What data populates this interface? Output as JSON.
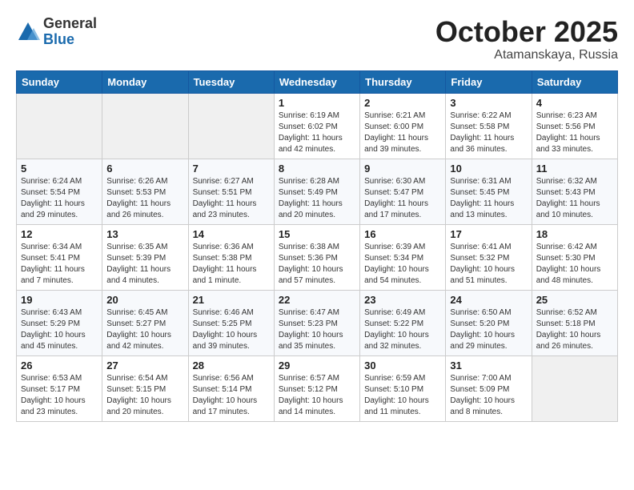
{
  "header": {
    "logo": {
      "general": "General",
      "blue": "Blue"
    },
    "title": "October 2025",
    "subtitle": "Atamanskaya, Russia"
  },
  "weekdays": [
    "Sunday",
    "Monday",
    "Tuesday",
    "Wednesday",
    "Thursday",
    "Friday",
    "Saturday"
  ],
  "weeks": [
    [
      {
        "day": "",
        "info": ""
      },
      {
        "day": "",
        "info": ""
      },
      {
        "day": "",
        "info": ""
      },
      {
        "day": "1",
        "info": "Sunrise: 6:19 AM\nSunset: 6:02 PM\nDaylight: 11 hours\nand 42 minutes."
      },
      {
        "day": "2",
        "info": "Sunrise: 6:21 AM\nSunset: 6:00 PM\nDaylight: 11 hours\nand 39 minutes."
      },
      {
        "day": "3",
        "info": "Sunrise: 6:22 AM\nSunset: 5:58 PM\nDaylight: 11 hours\nand 36 minutes."
      },
      {
        "day": "4",
        "info": "Sunrise: 6:23 AM\nSunset: 5:56 PM\nDaylight: 11 hours\nand 33 minutes."
      }
    ],
    [
      {
        "day": "5",
        "info": "Sunrise: 6:24 AM\nSunset: 5:54 PM\nDaylight: 11 hours\nand 29 minutes."
      },
      {
        "day": "6",
        "info": "Sunrise: 6:26 AM\nSunset: 5:53 PM\nDaylight: 11 hours\nand 26 minutes."
      },
      {
        "day": "7",
        "info": "Sunrise: 6:27 AM\nSunset: 5:51 PM\nDaylight: 11 hours\nand 23 minutes."
      },
      {
        "day": "8",
        "info": "Sunrise: 6:28 AM\nSunset: 5:49 PM\nDaylight: 11 hours\nand 20 minutes."
      },
      {
        "day": "9",
        "info": "Sunrise: 6:30 AM\nSunset: 5:47 PM\nDaylight: 11 hours\nand 17 minutes."
      },
      {
        "day": "10",
        "info": "Sunrise: 6:31 AM\nSunset: 5:45 PM\nDaylight: 11 hours\nand 13 minutes."
      },
      {
        "day": "11",
        "info": "Sunrise: 6:32 AM\nSunset: 5:43 PM\nDaylight: 11 hours\nand 10 minutes."
      }
    ],
    [
      {
        "day": "12",
        "info": "Sunrise: 6:34 AM\nSunset: 5:41 PM\nDaylight: 11 hours\nand 7 minutes."
      },
      {
        "day": "13",
        "info": "Sunrise: 6:35 AM\nSunset: 5:39 PM\nDaylight: 11 hours\nand 4 minutes."
      },
      {
        "day": "14",
        "info": "Sunrise: 6:36 AM\nSunset: 5:38 PM\nDaylight: 11 hours\nand 1 minute."
      },
      {
        "day": "15",
        "info": "Sunrise: 6:38 AM\nSunset: 5:36 PM\nDaylight: 10 hours\nand 57 minutes."
      },
      {
        "day": "16",
        "info": "Sunrise: 6:39 AM\nSunset: 5:34 PM\nDaylight: 10 hours\nand 54 minutes."
      },
      {
        "day": "17",
        "info": "Sunrise: 6:41 AM\nSunset: 5:32 PM\nDaylight: 10 hours\nand 51 minutes."
      },
      {
        "day": "18",
        "info": "Sunrise: 6:42 AM\nSunset: 5:30 PM\nDaylight: 10 hours\nand 48 minutes."
      }
    ],
    [
      {
        "day": "19",
        "info": "Sunrise: 6:43 AM\nSunset: 5:29 PM\nDaylight: 10 hours\nand 45 minutes."
      },
      {
        "day": "20",
        "info": "Sunrise: 6:45 AM\nSunset: 5:27 PM\nDaylight: 10 hours\nand 42 minutes."
      },
      {
        "day": "21",
        "info": "Sunrise: 6:46 AM\nSunset: 5:25 PM\nDaylight: 10 hours\nand 39 minutes."
      },
      {
        "day": "22",
        "info": "Sunrise: 6:47 AM\nSunset: 5:23 PM\nDaylight: 10 hours\nand 35 minutes."
      },
      {
        "day": "23",
        "info": "Sunrise: 6:49 AM\nSunset: 5:22 PM\nDaylight: 10 hours\nand 32 minutes."
      },
      {
        "day": "24",
        "info": "Sunrise: 6:50 AM\nSunset: 5:20 PM\nDaylight: 10 hours\nand 29 minutes."
      },
      {
        "day": "25",
        "info": "Sunrise: 6:52 AM\nSunset: 5:18 PM\nDaylight: 10 hours\nand 26 minutes."
      }
    ],
    [
      {
        "day": "26",
        "info": "Sunrise: 6:53 AM\nSunset: 5:17 PM\nDaylight: 10 hours\nand 23 minutes."
      },
      {
        "day": "27",
        "info": "Sunrise: 6:54 AM\nSunset: 5:15 PM\nDaylight: 10 hours\nand 20 minutes."
      },
      {
        "day": "28",
        "info": "Sunrise: 6:56 AM\nSunset: 5:14 PM\nDaylight: 10 hours\nand 17 minutes."
      },
      {
        "day": "29",
        "info": "Sunrise: 6:57 AM\nSunset: 5:12 PM\nDaylight: 10 hours\nand 14 minutes."
      },
      {
        "day": "30",
        "info": "Sunrise: 6:59 AM\nSunset: 5:10 PM\nDaylight: 10 hours\nand 11 minutes."
      },
      {
        "day": "31",
        "info": "Sunrise: 7:00 AM\nSunset: 5:09 PM\nDaylight: 10 hours\nand 8 minutes."
      },
      {
        "day": "",
        "info": ""
      }
    ]
  ]
}
